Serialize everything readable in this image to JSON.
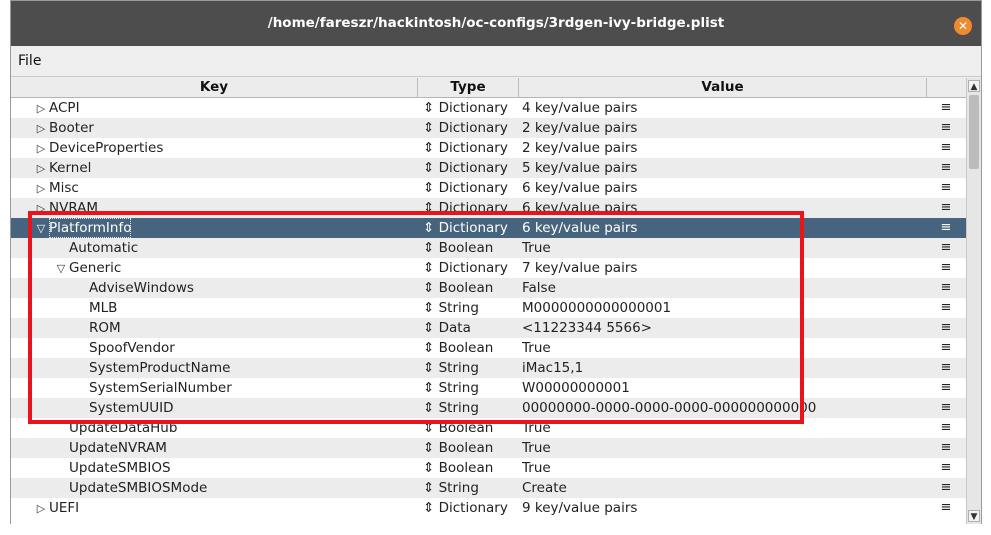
{
  "window": {
    "title": "/home/fareszr/hackintosh/oc-configs/3rdgen-ivy-bridge.plist",
    "close_glyph": "✕",
    "close_color": "#f08a2e"
  },
  "menu": {
    "file": "File"
  },
  "columns": {
    "key": "Key",
    "type": "Type",
    "value": "Value"
  },
  "rows": [
    {
      "key": "ACPI",
      "type": "⇕ Dictionary",
      "value": "4 key/value pairs",
      "expander": "closed",
      "indent": 0
    },
    {
      "key": "Booter",
      "type": "⇕ Dictionary",
      "value": "2 key/value pairs",
      "expander": "closed",
      "indent": 0
    },
    {
      "key": "DeviceProperties",
      "type": "⇕ Dictionary",
      "value": "2 key/value pairs",
      "expander": "closed",
      "indent": 0
    },
    {
      "key": "Kernel",
      "type": "⇕ Dictionary",
      "value": "5 key/value pairs",
      "expander": "closed",
      "indent": 0
    },
    {
      "key": "Misc",
      "type": "⇕ Dictionary",
      "value": "6 key/value pairs",
      "expander": "closed",
      "indent": 0
    },
    {
      "key": "NVRAM",
      "type": "⇕ Dictionary",
      "value": "6 key/value pairs",
      "expander": "closed",
      "indent": 0
    },
    {
      "key": "PlatformInfo",
      "type": "⇕ Dictionary",
      "value": "6 key/value pairs",
      "expander": "open",
      "indent": 0,
      "selected": true
    },
    {
      "key": "Automatic",
      "type": "⇕ Boolean",
      "value": "True",
      "expander": "none",
      "indent": 1
    },
    {
      "key": "Generic",
      "type": "⇕ Dictionary",
      "value": "7 key/value pairs",
      "expander": "open",
      "indent": 1
    },
    {
      "key": "AdviseWindows",
      "type": "⇕ Boolean",
      "value": "False",
      "expander": "none",
      "indent": 2
    },
    {
      "key": "MLB",
      "type": "⇕ String",
      "value": "M0000000000000001",
      "expander": "none",
      "indent": 2
    },
    {
      "key": "ROM",
      "type": "⇕ Data",
      "value": "<11223344 5566>",
      "expander": "none",
      "indent": 2
    },
    {
      "key": "SpoofVendor",
      "type": "⇕ Boolean",
      "value": "True",
      "expander": "none",
      "indent": 2
    },
    {
      "key": "SystemProductName",
      "type": "⇕ String",
      "value": "iMac15,1",
      "expander": "none",
      "indent": 2
    },
    {
      "key": "SystemSerialNumber",
      "type": "⇕ String",
      "value": "W00000000001",
      "expander": "none",
      "indent": 2
    },
    {
      "key": "SystemUUID",
      "type": "⇕ String",
      "value": "00000000-0000-0000-0000-000000000000",
      "expander": "none",
      "indent": 2
    },
    {
      "key": "UpdateDataHub",
      "type": "⇕ Boolean",
      "value": "True",
      "expander": "none",
      "indent": 1
    },
    {
      "key": "UpdateNVRAM",
      "type": "⇕ Boolean",
      "value": "True",
      "expander": "none",
      "indent": 1
    },
    {
      "key": "UpdateSMBIOS",
      "type": "⇕ Boolean",
      "value": "True",
      "expander": "none",
      "indent": 1
    },
    {
      "key": "UpdateSMBIOSMode",
      "type": "⇕ String",
      "value": "Create",
      "expander": "none",
      "indent": 1
    },
    {
      "key": "UEFI",
      "type": "⇕ Dictionary",
      "value": "9 key/value pairs",
      "expander": "closed",
      "indent": 0
    }
  ],
  "icons": {
    "closed": "▷",
    "open": "▽",
    "row_menu": "≡",
    "scroll_up": "▲",
    "scroll_down": "▼"
  },
  "colors": {
    "selected_row": "#47647f",
    "highlight_box": "#e8141a",
    "titlebar": "#4d4d4d"
  }
}
